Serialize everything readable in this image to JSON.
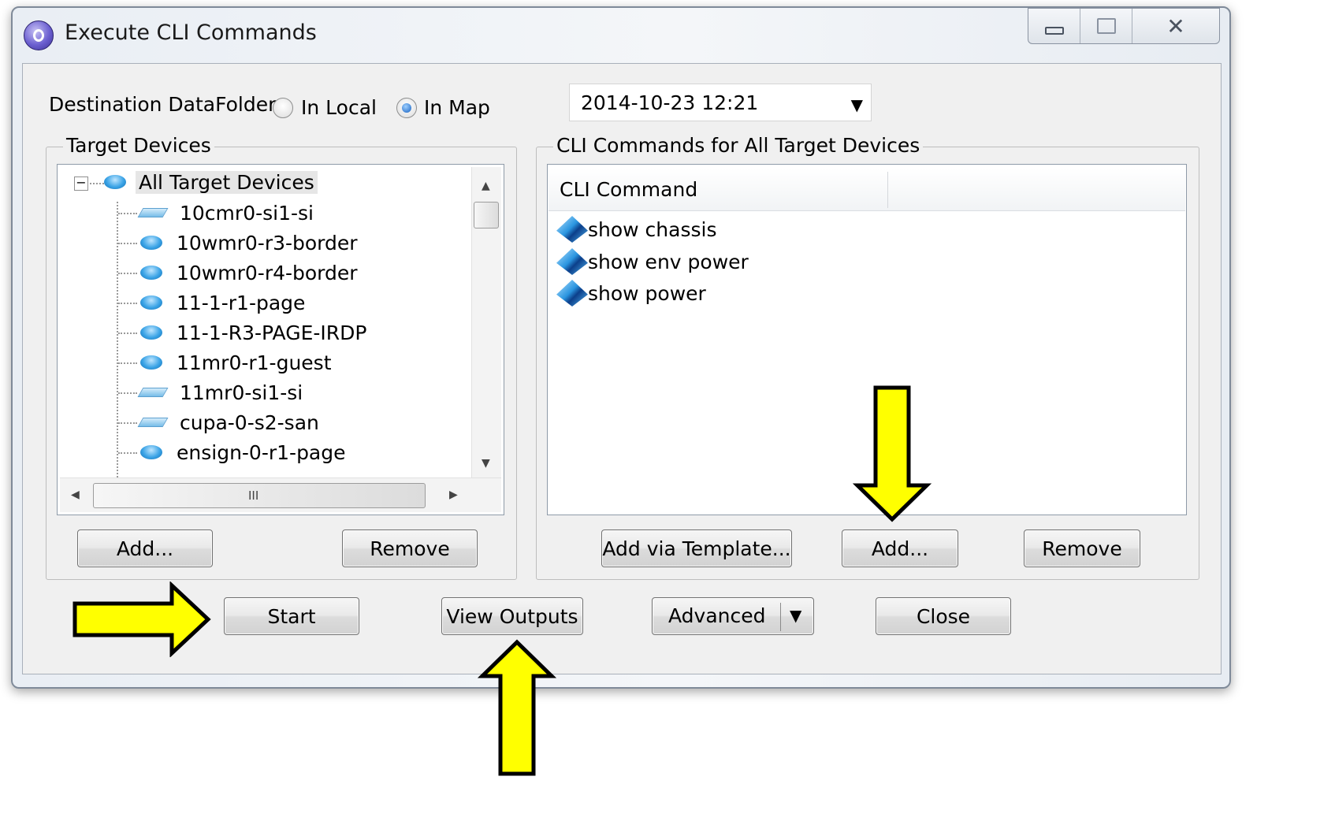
{
  "window": {
    "title": "Execute CLI Commands"
  },
  "title_controls": {
    "close_glyph": "✕"
  },
  "destination": {
    "label": "Destination DataFolder:",
    "options": [
      "In Local",
      "In Map"
    ],
    "selected": "In Map"
  },
  "datetime_combo": {
    "value": "2014-10-23 12:21"
  },
  "target_devices": {
    "title": "Target Devices",
    "root": "All Target Devices",
    "root_toggle": "−",
    "items": [
      {
        "name": "10cmr0-si1-si",
        "icon": "switch-icon"
      },
      {
        "name": "10wmr0-r3-border",
        "icon": "router-icon"
      },
      {
        "name": "10wmr0-r4-border",
        "icon": "router-icon"
      },
      {
        "name": "11-1-r1-page",
        "icon": "router-icon"
      },
      {
        "name": "11-1-R3-PAGE-IRDP",
        "icon": "router-icon"
      },
      {
        "name": "11mr0-r1-guest",
        "icon": "router-icon"
      },
      {
        "name": "11mr0-si1-si",
        "icon": "switch-icon"
      },
      {
        "name": "cupa-0-s2-san",
        "icon": "switch-icon"
      },
      {
        "name": "ensign-0-r1-page",
        "icon": "router-icon"
      }
    ],
    "add_label": "Add...",
    "remove_label": "Remove",
    "scroll_glyphs": {
      "up": "▲",
      "down": "▼",
      "left": "◀",
      "right": "▶",
      "grip": "III"
    }
  },
  "cli_commands": {
    "title": "CLI Commands  for All Target Devices",
    "column_header": "CLI Command",
    "items": [
      "show chassis",
      "show env power",
      "show power"
    ],
    "add_template_label": "Add via Template...",
    "add_label": "Add...",
    "remove_label": "Remove"
  },
  "bottom_bar": {
    "start_label": "Start",
    "view_outputs_label": "View Outputs",
    "advanced_label": "Advanced",
    "advanced_arrow": "▼",
    "close_label": "Close"
  },
  "combo_arrow": "▼",
  "colors": {
    "callout_arrow": "#ffff00",
    "window_border": "#7f8a99"
  }
}
